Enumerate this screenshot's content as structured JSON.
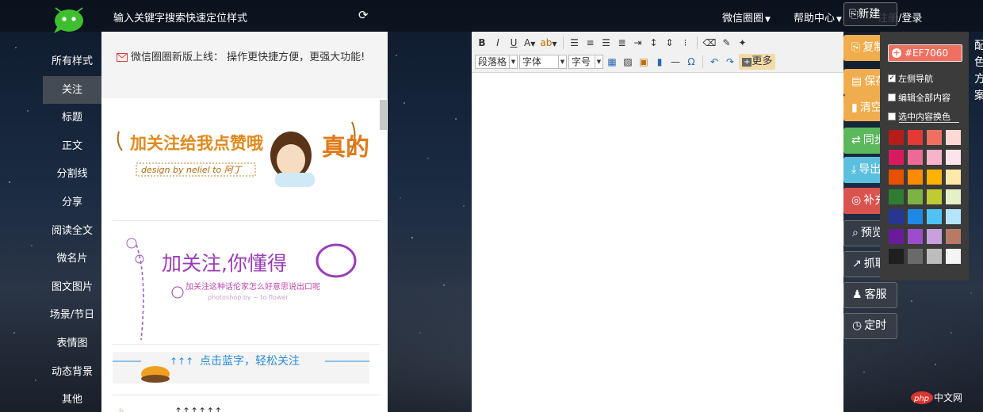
{
  "topbar": {
    "search_label": "输入关键字搜索快速定位样式",
    "nav": [
      {
        "label": "微信圈圈"
      },
      {
        "label": "帮助中心"
      }
    ],
    "login": "注册/登录",
    "new_button": "新建"
  },
  "sidebar": {
    "items": [
      "所有样式",
      "关注",
      "标题",
      "正文",
      "分割线",
      "分享",
      "阅读全文",
      "微名片",
      "图文图片",
      "场景/节日",
      "表情图",
      "动态背景",
      "其他"
    ],
    "active": "关注"
  },
  "panel": {
    "notice": "微信圈圈新版上线：  操作更快捷方便，更强大功能!",
    "cards": [
      {
        "text": "加关注给我点赞哦",
        "subtext": "design by neliel to 阿丁",
        "side_text": "真的"
      },
      {
        "text": "加关注,你懂得",
        "subtext": "加关注这种话伦家怎么好意思说出口呢",
        "credit": "photoshop by ~ to flower"
      },
      {
        "text": "点击蓝字，轻松关注"
      },
      {
        "text": "↑↑↑↑↑↑"
      }
    ]
  },
  "editor": {
    "row1": [
      "B",
      "I",
      "U",
      "A",
      "ab"
    ],
    "selects": [
      {
        "label": "段落格"
      },
      {
        "label": "字体"
      },
      {
        "label": "字号"
      }
    ],
    "more": "更多"
  },
  "actions": [
    {
      "label": "复制",
      "icon": "copy-icon",
      "color": "#f0ad4e"
    },
    {
      "label": "保存",
      "icon": "save-icon",
      "color": "#f0ad4e"
    },
    {
      "label": "清空",
      "icon": "trash-icon",
      "color": "#f0ad4e"
    },
    {
      "label": "同步",
      "icon": "exchange-icon",
      "color": "#5cb85c"
    },
    {
      "label": "导出",
      "icon": "download-icon",
      "color": "#5bc0de"
    },
    {
      "label": "补充",
      "icon": "lifebuoy-icon",
      "color": "#d9534f"
    },
    {
      "label": "预览",
      "icon": "search-icon",
      "color": ""
    },
    {
      "label": "抓取",
      "icon": "external-link-icon",
      "color": ""
    },
    {
      "label": "客服",
      "icon": "bell-icon",
      "color": ""
    },
    {
      "label": "定时",
      "icon": "clock-icon",
      "color": ""
    }
  ],
  "color_panel": {
    "value": "#EF7060",
    "options": [
      {
        "label": "左侧导航",
        "checked": true
      },
      {
        "label": "编辑全部内容",
        "checked": false
      },
      {
        "label": "选中内容换色",
        "checked": false
      }
    ],
    "swatches": [
      "#b71c1c",
      "#e53935",
      "#ef7060",
      "#fcd9d3",
      "#d81b60",
      "#ec6a96",
      "#f7b3c8",
      "#fde4ec",
      "#e65100",
      "#fb8c00",
      "#ffb300",
      "#ffe9a8",
      "#2e7d32",
      "#7cb342",
      "#c0ca33",
      "#e6f0c6",
      "#283593",
      "#1e88e5",
      "#4fc3f7",
      "#b3e5fc",
      "#6a1b9a",
      "#9c4dcc",
      "#c7a0dc",
      "#b87a66",
      "#1f1f1f",
      "#6a6a6a",
      "#bdbdbd",
      "#f5f5f5"
    ]
  },
  "edge_text": [
    "配",
    "色",
    "方",
    "案"
  ],
  "watermark": "中文网"
}
